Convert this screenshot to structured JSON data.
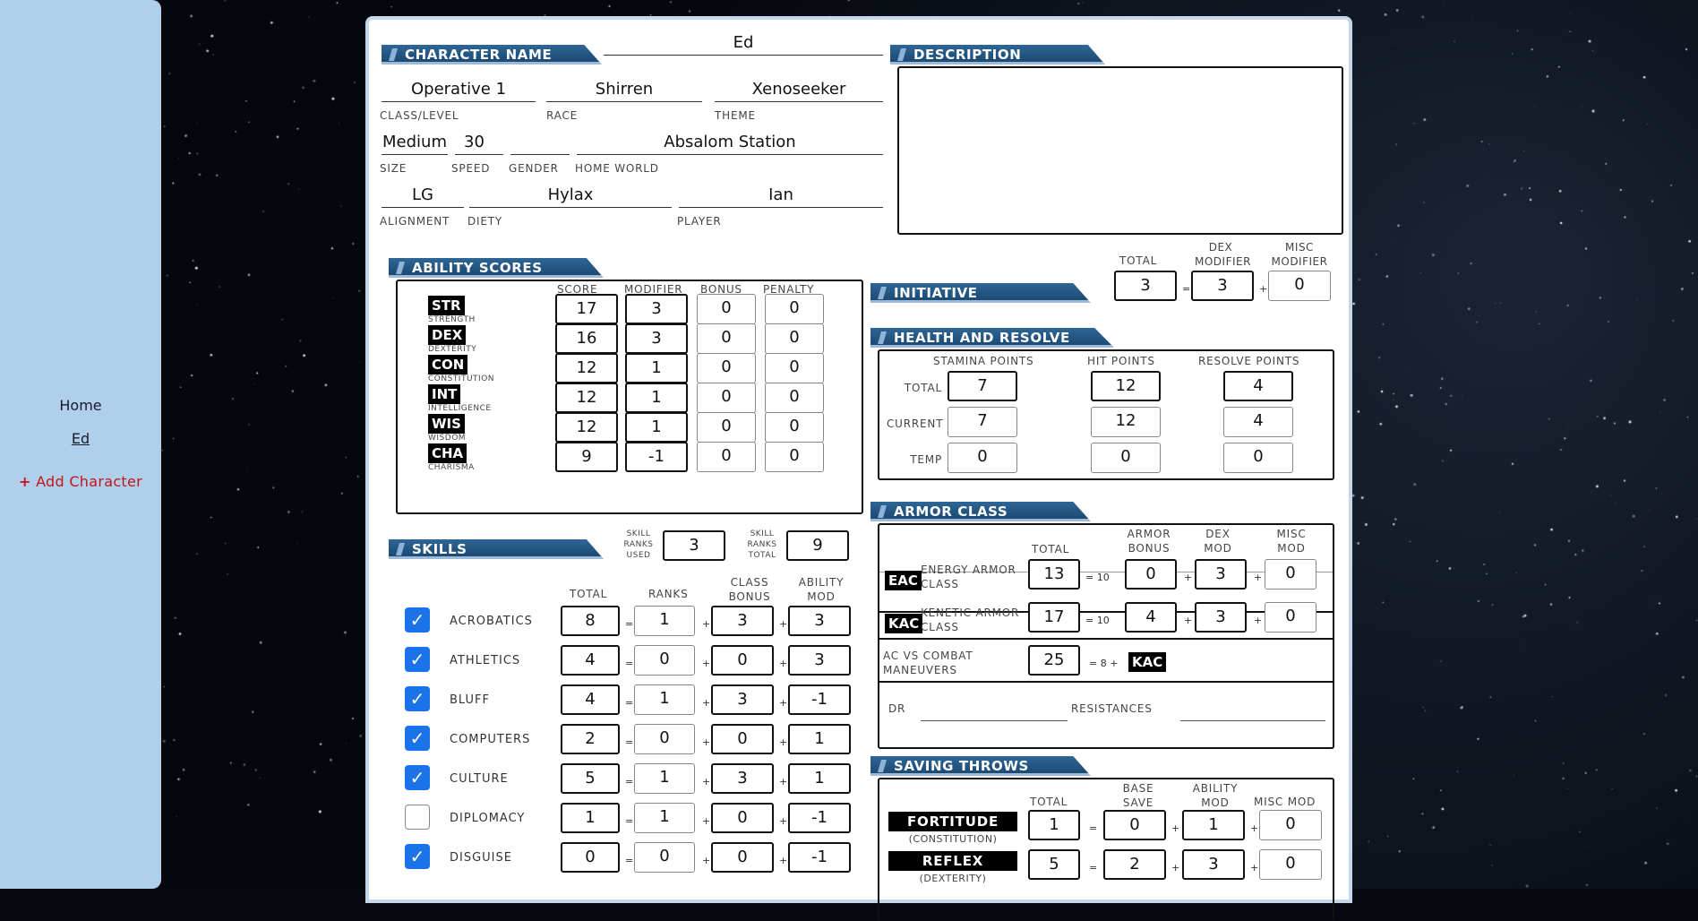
{
  "sidebar": {
    "home": "Home",
    "character": "Ed",
    "add_character": "Add Character",
    "add_icon": "+"
  },
  "header": {
    "character_name_title": "CHARACTER NAME",
    "character_name": "Ed",
    "description_title": "DESCRIPTION"
  },
  "identity": {
    "class_level": {
      "value": "Operative 1",
      "label": "CLASS/LEVEL"
    },
    "race": {
      "value": "Shirren",
      "label": "RACE"
    },
    "theme": {
      "value": "Xenoseeker",
      "label": "THEME"
    },
    "size": {
      "value": "Medium",
      "label": "SIZE"
    },
    "speed": {
      "value": "30",
      "label": "SPEED"
    },
    "gender": {
      "value": "",
      "label": "GENDER"
    },
    "home_world": {
      "value": "Absalom Station",
      "label": "HOME WORLD"
    },
    "alignment": {
      "value": "LG",
      "label": "ALIGNMENT"
    },
    "diety": {
      "value": "Hylax",
      "label": "DIETY"
    },
    "player": {
      "value": "Ian",
      "label": "PLAYER"
    }
  },
  "ability_scores": {
    "title": "ABILITY SCORES",
    "col_score": "SCORE",
    "col_modifier": "MODIFIER",
    "col_bonus": "BONUS",
    "col_penalty": "PENALTY",
    "rows": [
      {
        "abbr": "STR",
        "name": "STRENGTH",
        "score": "17",
        "modifier": "3",
        "bonus": "0",
        "penalty": "0"
      },
      {
        "abbr": "DEX",
        "name": "DEXTERITY",
        "score": "16",
        "modifier": "3",
        "bonus": "0",
        "penalty": "0"
      },
      {
        "abbr": "CON",
        "name": "CONSTITUTION",
        "score": "12",
        "modifier": "1",
        "bonus": "0",
        "penalty": "0"
      },
      {
        "abbr": "INT",
        "name": "INTELLIGENCE",
        "score": "12",
        "modifier": "1",
        "bonus": "0",
        "penalty": "0"
      },
      {
        "abbr": "WIS",
        "name": "WISDOM",
        "score": "12",
        "modifier": "1",
        "bonus": "0",
        "penalty": "0"
      },
      {
        "abbr": "CHA",
        "name": "CHARISMA",
        "score": "9",
        "modifier": "-1",
        "bonus": "0",
        "penalty": "0"
      }
    ]
  },
  "initiative": {
    "title": "INITIATIVE",
    "total_label": "TOTAL",
    "dex_label": "DEX MODIFIER",
    "misc_label": "MISC MODIFIER",
    "total": "3",
    "dex": "3",
    "misc": "0",
    "eq": "=",
    "plus": "+"
  },
  "health": {
    "title": "HEALTH AND RESOLVE",
    "col_stamina": "STAMINA POINTS",
    "col_hit": "HIT POINTS",
    "col_resolve": "RESOLVE POINTS",
    "rows": [
      {
        "label": "TOTAL",
        "stamina": "7",
        "hit": "12",
        "resolve": "4"
      },
      {
        "label": "CURRENT",
        "stamina": "7",
        "hit": "12",
        "resolve": "4"
      },
      {
        "label": "TEMP",
        "stamina": "0",
        "hit": "0",
        "resolve": "0"
      }
    ]
  },
  "skills": {
    "title": "SKILLS",
    "ranks_used_label": "SKILL RANKS USED",
    "ranks_used": "3",
    "ranks_total_label": "SKILL RANKS TOTAL",
    "ranks_total": "9",
    "col_total": "TOTAL",
    "col_ranks": "RANKS",
    "col_class": "CLASS BONUS",
    "col_ability": "ABILITY MOD",
    "eq": "=",
    "plus": "+",
    "rows": [
      {
        "checked": true,
        "name": "ACROBATICS",
        "total": "8",
        "ranks": "1",
        "class": "3",
        "ability": "3"
      },
      {
        "checked": true,
        "name": "ATHLETICS",
        "total": "4",
        "ranks": "0",
        "class": "0",
        "ability": "3"
      },
      {
        "checked": true,
        "name": "BLUFF",
        "total": "4",
        "ranks": "1",
        "class": "3",
        "ability": "-1"
      },
      {
        "checked": true,
        "name": "COMPUTERS",
        "total": "2",
        "ranks": "0",
        "class": "0",
        "ability": "1"
      },
      {
        "checked": true,
        "name": "CULTURE",
        "total": "5",
        "ranks": "1",
        "class": "3",
        "ability": "1"
      },
      {
        "checked": false,
        "name": "DIPLOMACY",
        "total": "1",
        "ranks": "1",
        "class": "0",
        "ability": "-1"
      },
      {
        "checked": true,
        "name": "DISGUISE",
        "total": "0",
        "ranks": "0",
        "class": "0",
        "ability": "-1"
      }
    ],
    "check_glyph": "✓"
  },
  "armor_class": {
    "title": "ARMOR CLASS",
    "col_total": "TOTAL",
    "col_armor": "ARMOR BONUS",
    "col_dex": "DEX MOD",
    "col_misc": "MISC MOD",
    "eac": {
      "abbr": "EAC",
      "name": "ENERGY ARMOR CLASS",
      "total": "13",
      "base": "= 10",
      "armor": "0",
      "dex": "3",
      "misc": "0"
    },
    "kac": {
      "abbr": "KAC",
      "name": "KENETIC ARMOR CLASS",
      "total": "17",
      "base": "= 10",
      "armor": "4",
      "dex": "3",
      "misc": "0"
    },
    "cmd": {
      "name": "AC VS COMBAT MANEUVERS",
      "total": "25",
      "formula": "= 8 +",
      "ref": "KAC"
    },
    "dr_label": "DR",
    "resistances_label": "RESISTANCES",
    "plus": "+"
  },
  "saving_throws": {
    "title": "SAVING THROWS",
    "col_total": "TOTAL",
    "col_base": "BASE SAVE",
    "col_ability": "ABILITY MOD",
    "col_misc": "MISC MOD",
    "eq": "=",
    "plus": "+",
    "rows": [
      {
        "name": "FORTITUDE",
        "sub": "(CONSTITUTION)",
        "total": "1",
        "base": "0",
        "ability": "1",
        "misc": "0"
      },
      {
        "name": "REFLEX",
        "sub": "(DEXTERITY)",
        "total": "5",
        "base": "2",
        "ability": "3",
        "misc": "0"
      }
    ]
  }
}
